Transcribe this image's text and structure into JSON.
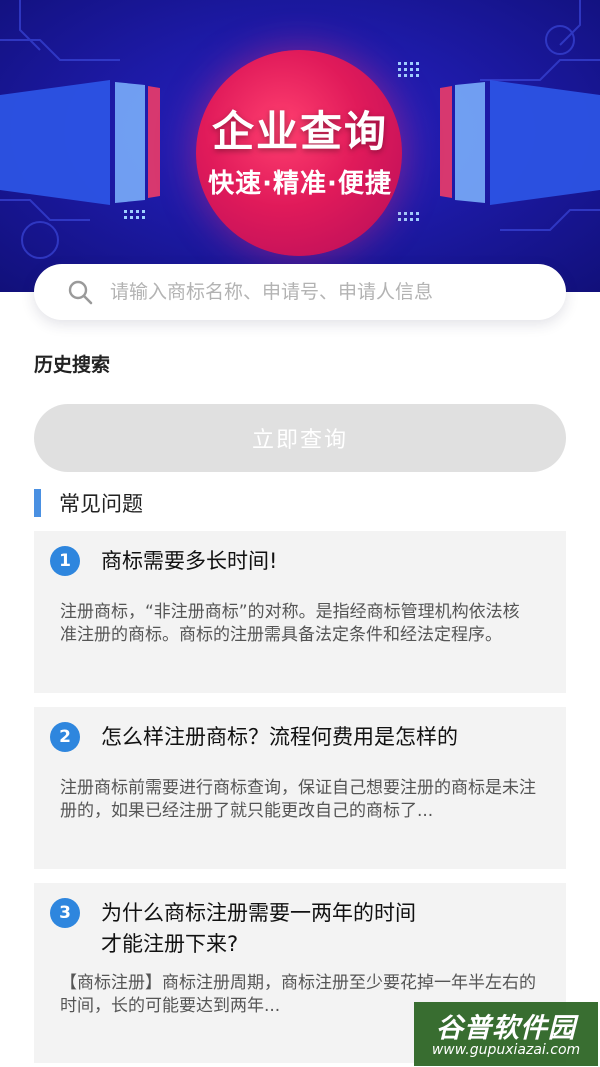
{
  "banner": {
    "title": "企业查询",
    "subtitle": "快速·精准·便捷"
  },
  "search": {
    "placeholder": "请输入商标名称、申请号、申请人信息",
    "value": ""
  },
  "history": {
    "title": "历史搜索"
  },
  "query_button": {
    "label": "立即查询"
  },
  "faq": {
    "title": "常见问题",
    "items": [
      {
        "number": "1",
        "question": "商标需要多长时间!",
        "answer": "注册商标，“非注册商标”的对称。是指经商标管理机构依法核准注册的商标。商标的注册需具备法定条件和经法定程序。"
      },
      {
        "number": "2",
        "question": "怎么样注册商标？流程何费用是怎样的",
        "answer": "注册商标前需要进行商标查询，保证自己想要注册的商标是未注册的，如果已经注册了就只能更改自己的商标了..."
      },
      {
        "number": "3",
        "question": "为什么商标注册需要一两年的时间\n才能注册下来?",
        "answer": "【商标注册】商标注册周期，商标注册至少要花掉一年半左右的时间，长的可能要达到两年..."
      }
    ]
  },
  "watermark": {
    "brand": "谷普软件园",
    "url": "www.gupuxiazai.com"
  },
  "colors": {
    "banner_blue": "#1d1aa6",
    "banner_red": "#e01a5a",
    "accent_blue": "#2e86de",
    "section_bar": "#4a90e2",
    "button_disabled": "#e0e0e0",
    "card_bg": "#f3f3f3"
  },
  "icons": {
    "search": "search-icon"
  }
}
